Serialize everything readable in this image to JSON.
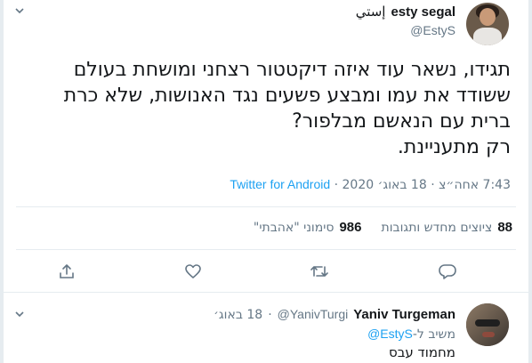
{
  "tweet": {
    "author_name": "esty segal",
    "author_name_ar": "إستي",
    "handle": "@EstyS",
    "body": "תגידו, נשאר עוד איזה דיקטטור רצחני ומושחת בעולם\nששודד את עמו ומבצע פשעים נגד האנושות, שלא כרת\nברית עם הנאשם מבלפור?\nרק מתעניינת.",
    "time": "7:43 אחה״צ",
    "separator": "·",
    "date": "18 באוג׳ 2020",
    "source": "Twitter for Android",
    "retweets_count": "88",
    "retweets_label": "ציוצים מחדש ותגובות",
    "likes_count": "986",
    "likes_label": "סימוני \"אהבתי\""
  },
  "actions": {
    "reply_icon": "comment-icon",
    "retweet_icon": "retweet-icon",
    "like_icon": "heart-icon",
    "share_icon": "share-icon"
  },
  "reply": {
    "author_name": "Yaniv Turgeman",
    "handle": "@YanivTurgi",
    "separator": "·",
    "date": "18 באוג׳",
    "replying_prefix": "משיב ל-",
    "replying_to": "@EstyS",
    "text": "מחמוד עבס"
  },
  "colors": {
    "accent": "#1da1f2",
    "secondary_text": "#657786",
    "divider": "#e6ecf0"
  }
}
